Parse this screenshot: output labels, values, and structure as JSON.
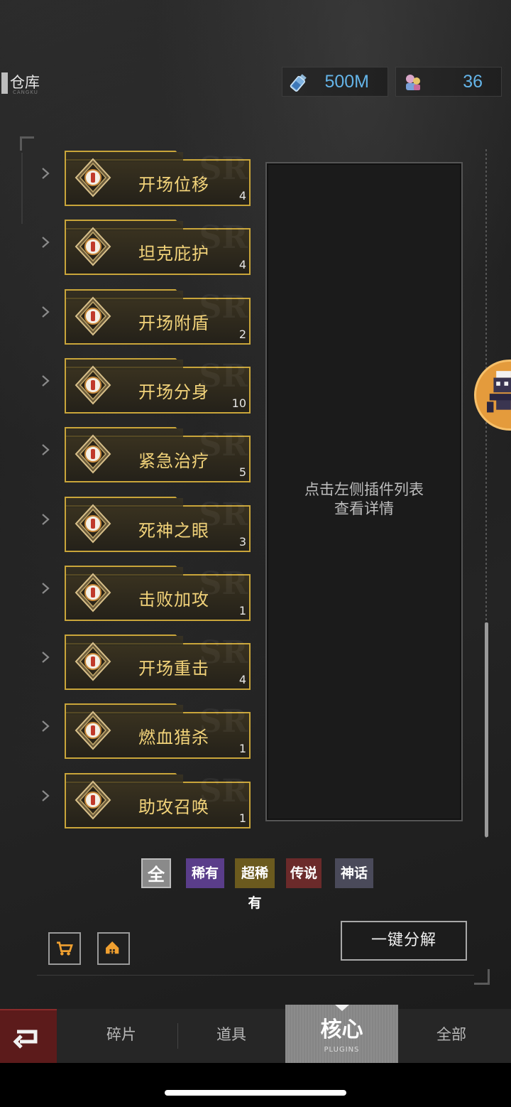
{
  "header": {
    "title": "仓库",
    "subtitle": "CANGKU",
    "currencies": [
      {
        "icon": "potion-bottle-icon",
        "value": "500M"
      },
      {
        "icon": "character-token-icon",
        "value": "36"
      }
    ]
  },
  "plugins": [
    {
      "name": "开场位移",
      "count": "4",
      "icon": "dash-move-icon"
    },
    {
      "name": "坦克庇护",
      "count": "4",
      "icon": "tank-shield-icon"
    },
    {
      "name": "开场附盾",
      "count": "2",
      "icon": "shield-icon"
    },
    {
      "name": "开场分身",
      "count": "10",
      "icon": "clone-icon"
    },
    {
      "name": "紧急治疗",
      "count": "5",
      "icon": "heal-heart-icon"
    },
    {
      "name": "死神之眼",
      "count": "3",
      "icon": "reaper-eye-icon"
    },
    {
      "name": "击败加攻",
      "count": "1",
      "icon": "attack-boost-icon"
    },
    {
      "name": "开场重击",
      "count": "4",
      "icon": "heavy-strike-icon"
    },
    {
      "name": "燃血猎杀",
      "count": "1",
      "icon": "blood-hunt-icon"
    },
    {
      "name": "助攻召唤",
      "count": "1",
      "icon": "summon-icon"
    }
  ],
  "detail": {
    "hint_line1": "点击左侧插件列表",
    "hint_line2": "查看详情"
  },
  "rarity_filters": [
    {
      "label": "全",
      "color": "#8a8a8a"
    },
    {
      "label": "稀有",
      "color": "#5a3d8a"
    },
    {
      "label": "超稀有",
      "color": "#6b5a1e"
    },
    {
      "label": "传说",
      "color": "#6b2a2a"
    },
    {
      "label": "神话",
      "color": "#4a4a5a"
    }
  ],
  "actions": {
    "decompose_label": "一键分解"
  },
  "tabs": [
    {
      "label": "碎片"
    },
    {
      "label": "道具"
    },
    {
      "label": "核心",
      "sub": "PLUGINS",
      "active": true
    },
    {
      "label": "全部"
    }
  ],
  "colors": {
    "accent_gold": "#c9a53a",
    "plugin_name": "#f2d37a",
    "currency_value": "#64b4e8"
  }
}
